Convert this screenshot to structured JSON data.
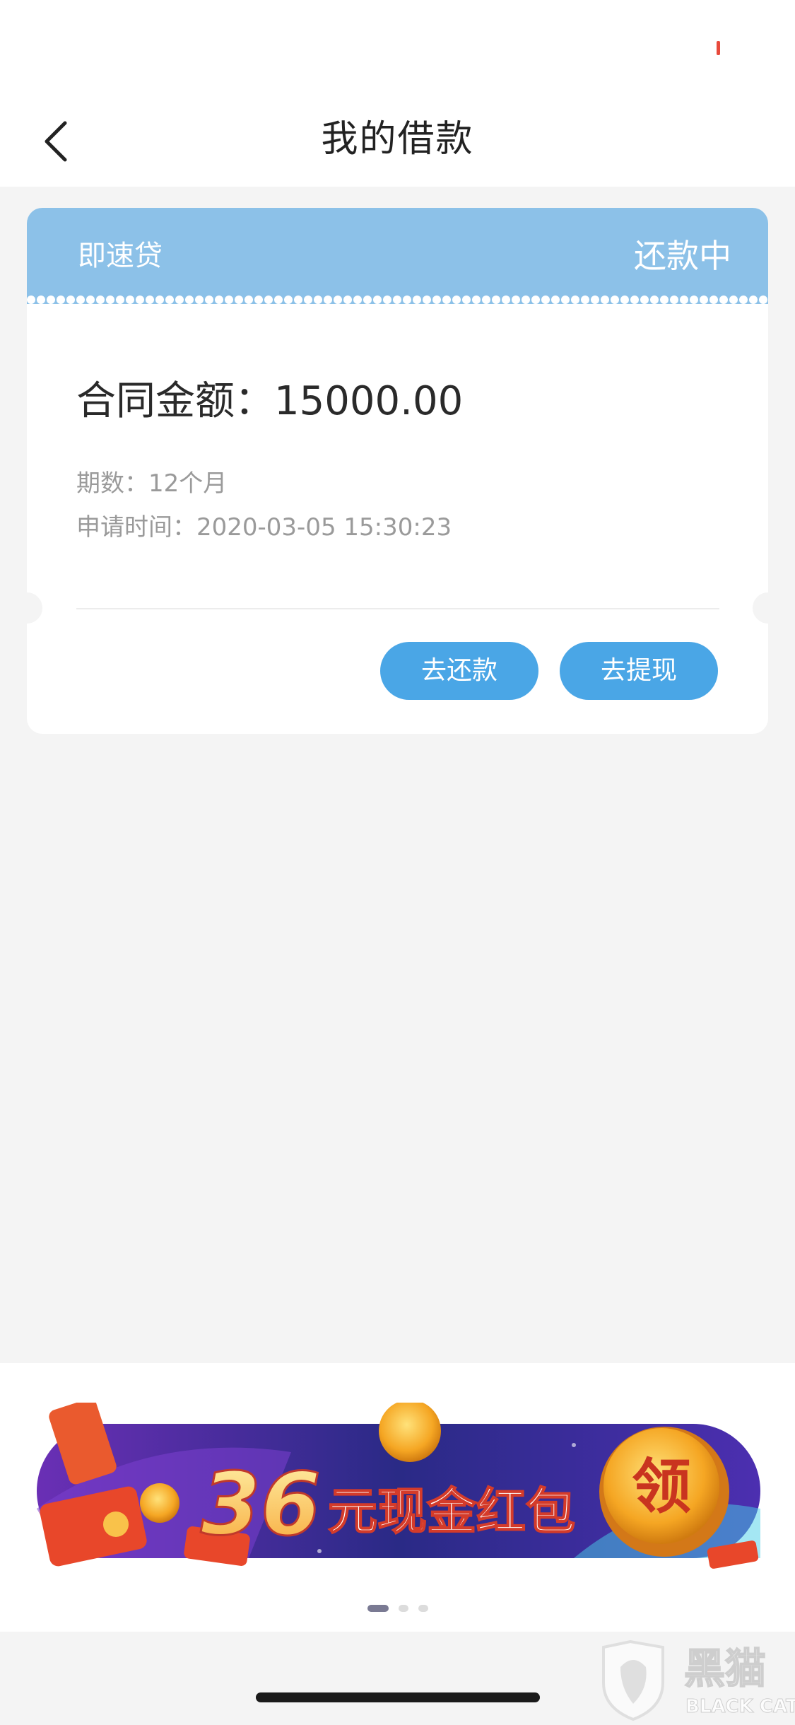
{
  "nav": {
    "title": "我的借款"
  },
  "loan_card": {
    "product_name": "即速贷",
    "status": "还款中",
    "amount_line": "合同金额：15000.00",
    "term_line": "期数：12个月",
    "apply_time_line": "申请时间：2020-03-05 15:30:23",
    "repay_button": "去还款",
    "withdraw_button": "去提现"
  },
  "banner": {
    "amount": "36",
    "text": "元现金红包",
    "claim": "领",
    "slides": 3,
    "active_slide": 1
  },
  "watermark": {
    "cn": "黑猫",
    "en": "BLACK CAT"
  },
  "colors": {
    "card_header": "#8cc1e8",
    "button": "#4aa6e6",
    "page_bg": "#f4f4f4"
  }
}
